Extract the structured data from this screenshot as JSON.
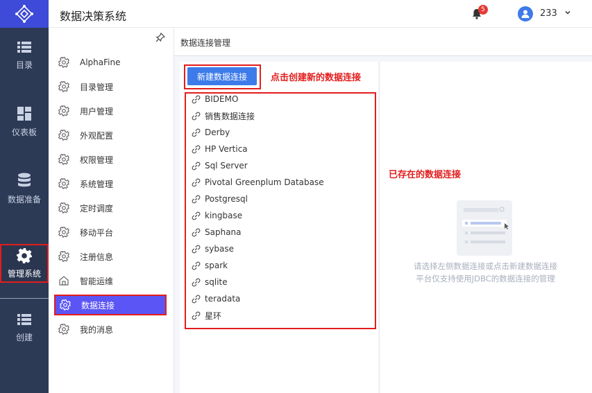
{
  "header": {
    "title": "数据决策系统",
    "notification_count": "5",
    "username": "233"
  },
  "leftnav": {
    "items": [
      {
        "label": "目录",
        "icon": "list-icon"
      },
      {
        "label": "仪表板",
        "icon": "dashboard-icon"
      },
      {
        "label": "数据准备",
        "icon": "database-icon"
      },
      {
        "label": "管理系统",
        "icon": "gear-icon",
        "active": true
      },
      {
        "label": "创建",
        "icon": "list-icon"
      }
    ]
  },
  "sidebar": {
    "items": [
      {
        "label": "AlphaFine"
      },
      {
        "label": "目录管理"
      },
      {
        "label": "用户管理"
      },
      {
        "label": "外观配置"
      },
      {
        "label": "权限管理"
      },
      {
        "label": "系统管理"
      },
      {
        "label": "定时调度"
      },
      {
        "label": "移动平台"
      },
      {
        "label": "注册信息"
      },
      {
        "label": "智能运维"
      },
      {
        "label": "数据连接",
        "active": true
      },
      {
        "label": "我的消息"
      }
    ]
  },
  "content": {
    "breadcrumb": "数据连接管理",
    "new_button_label": "新建数据连接",
    "annotation_new": "点击创建新的数据连接",
    "annotation_existing": "已存在的数据连接",
    "connections": [
      "BIDEMO",
      "销售数据连接",
      "Derby",
      "HP Vertica",
      "Sql Server",
      "Pivotal Greenplum Database",
      "Postgresql",
      "kingbase",
      "Saphana",
      "sybase",
      "spark",
      "sqlite",
      "teradata",
      "星环"
    ],
    "empty_line1": "请选择左侧数据连接或点击新建数据连接",
    "empty_line2": "平台仅支持使用JDBC的数据连接的管理"
  },
  "colors": {
    "brand": "#3d4bd8",
    "nav_bg": "#2d3a55",
    "active_item": "#5b55f5",
    "primary_button": "#3d7bea",
    "annotation_red": "#e31c1c"
  }
}
